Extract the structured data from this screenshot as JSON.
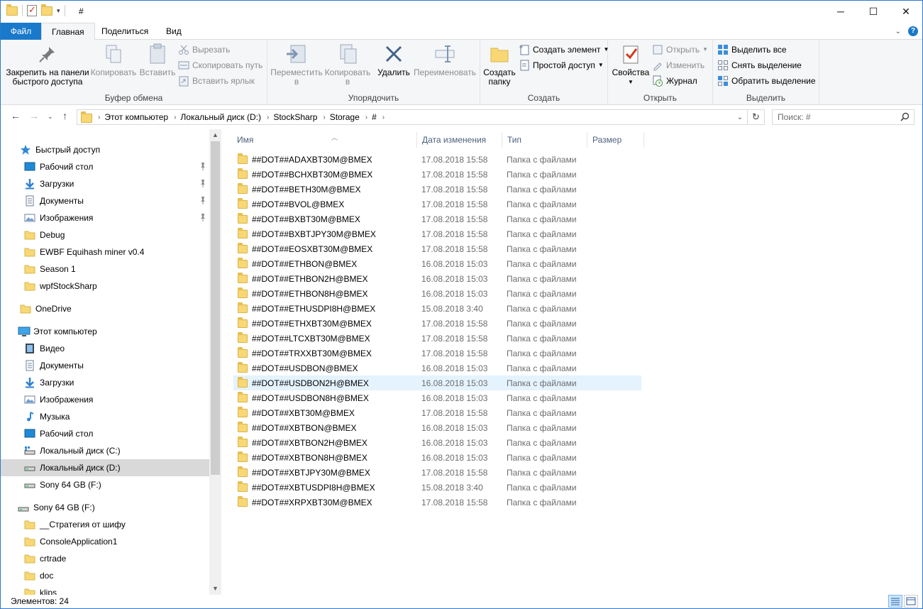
{
  "window": {
    "title": "#",
    "controls": {
      "minimize": "─",
      "maximize": "☐",
      "close": "✕"
    }
  },
  "ribbon_tabs": [
    {
      "label": "Файл"
    },
    {
      "label": "Главная"
    },
    {
      "label": "Поделиться"
    },
    {
      "label": "Вид"
    }
  ],
  "ribbon": {
    "clipboard": {
      "label": "Буфер обмена",
      "pin": "Закрепить на панели быстрого доступа",
      "pin_line1": "Закрепить на панели",
      "pin_line2": "быстрого доступа",
      "copy": "Копировать",
      "paste": "Вставить",
      "cut": "Вырезать",
      "copy_path": "Скопировать путь",
      "paste_shortcut": "Вставить ярлык"
    },
    "organize": {
      "label": "Упорядочить",
      "move_line1": "Переместить",
      "move_line2": "в",
      "copy_line1": "Копировать",
      "copy_line2": "в",
      "delete": "Удалить",
      "rename": "Переименовать"
    },
    "create": {
      "label": "Создать",
      "new_folder_line1": "Создать",
      "new_folder_line2": "папку",
      "new_item": "Создать элемент",
      "easy_access": "Простой доступ"
    },
    "open": {
      "label": "Открыть",
      "properties": "Свойства",
      "open": "Открыть",
      "edit": "Изменить",
      "history": "Журнал"
    },
    "select": {
      "label": "Выделить",
      "select_all": "Выделить все",
      "select_none": "Снять выделение",
      "invert": "Обратить выделение"
    }
  },
  "address": {
    "crumbs": [
      "Этот компьютер",
      "Локальный диск (D:)",
      "StockSharp",
      "Storage",
      "#"
    ]
  },
  "search": {
    "placeholder": "Поиск: #"
  },
  "nav": {
    "quick_access": "Быстрый доступ",
    "quick_items": [
      {
        "label": "Рабочий стол",
        "icon": "desktop-icon",
        "pinned": true
      },
      {
        "label": "Загрузки",
        "icon": "downloads-icon",
        "pinned": true
      },
      {
        "label": "Документы",
        "icon": "documents-icon",
        "pinned": true
      },
      {
        "label": "Изображения",
        "icon": "pictures-icon",
        "pinned": true
      },
      {
        "label": "Debug",
        "icon": "folder-icon",
        "pinned": false
      },
      {
        "label": "EWBF Equihash miner v0.4",
        "icon": "folder-icon",
        "pinned": false
      },
      {
        "label": "Season 1",
        "icon": "folder-icon",
        "pinned": false
      },
      {
        "label": "wpfStockSharp",
        "icon": "folder-icon",
        "pinned": false
      }
    ],
    "onedrive": "OneDrive",
    "this_pc": "Этот компьютер",
    "pc_items": [
      {
        "label": "Видео",
        "icon": "video-icon"
      },
      {
        "label": "Документы",
        "icon": "documents-icon"
      },
      {
        "label": "Загрузки",
        "icon": "downloads-icon"
      },
      {
        "label": "Изображения",
        "icon": "pictures-icon"
      },
      {
        "label": "Музыка",
        "icon": "music-icon"
      },
      {
        "label": "Рабочий стол",
        "icon": "desktop-icon"
      },
      {
        "label": "Локальный диск (C:)",
        "icon": "drive-c-icon"
      },
      {
        "label": "Локальный диск (D:)",
        "icon": "drive-icon"
      },
      {
        "label": "Sony 64 GB (F:)",
        "icon": "usb-drive-icon"
      }
    ],
    "sony": "Sony 64 GB (F:)",
    "sony_items": [
      {
        "label": "__Стратегия от шифу",
        "icon": "folder-icon"
      },
      {
        "label": "ConsoleApplication1",
        "icon": "folder-icon"
      },
      {
        "label": "crtrade",
        "icon": "folder-icon"
      },
      {
        "label": "doc",
        "icon": "folder-icon"
      },
      {
        "label": "klips",
        "icon": "folder-icon"
      }
    ]
  },
  "columns": {
    "name": "Имя",
    "date": "Дата изменения",
    "type": "Тип",
    "size": "Размер"
  },
  "files": [
    {
      "name": "##DOT##ADAXBT30M@BMEX",
      "date": "17.08.2018 15:58",
      "type": "Папка с файлами"
    },
    {
      "name": "##DOT##BCHXBT30M@BMEX",
      "date": "17.08.2018 15:58",
      "type": "Папка с файлами"
    },
    {
      "name": "##DOT##BETH30M@BMEX",
      "date": "17.08.2018 15:58",
      "type": "Папка с файлами"
    },
    {
      "name": "##DOT##BVOL@BMEX",
      "date": "17.08.2018 15:58",
      "type": "Папка с файлами"
    },
    {
      "name": "##DOT##BXBT30M@BMEX",
      "date": "17.08.2018 15:58",
      "type": "Папка с файлами"
    },
    {
      "name": "##DOT##BXBTJPY30M@BMEX",
      "date": "17.08.2018 15:58",
      "type": "Папка с файлами"
    },
    {
      "name": "##DOT##EOSXBT30M@BMEX",
      "date": "17.08.2018 15:58",
      "type": "Папка с файлами"
    },
    {
      "name": "##DOT##ETHBON@BMEX",
      "date": "16.08.2018 15:03",
      "type": "Папка с файлами"
    },
    {
      "name": "##DOT##ETHBON2H@BMEX",
      "date": "16.08.2018 15:03",
      "type": "Папка с файлами"
    },
    {
      "name": "##DOT##ETHBON8H@BMEX",
      "date": "16.08.2018 15:03",
      "type": "Папка с файлами"
    },
    {
      "name": "##DOT##ETHUSDPI8H@BMEX",
      "date": "15.08.2018 3:40",
      "type": "Папка с файлами"
    },
    {
      "name": "##DOT##ETHXBT30M@BMEX",
      "date": "17.08.2018 15:58",
      "type": "Папка с файлами"
    },
    {
      "name": "##DOT##LTCXBT30M@BMEX",
      "date": "17.08.2018 15:58",
      "type": "Папка с файлами"
    },
    {
      "name": "##DOT##TRXXBT30M@BMEX",
      "date": "17.08.2018 15:58",
      "type": "Папка с файлами"
    },
    {
      "name": "##DOT##USDBON@BMEX",
      "date": "16.08.2018 15:03",
      "type": "Папка с файлами"
    },
    {
      "name": "##DOT##USDBON2H@BMEX",
      "date": "16.08.2018 15:03",
      "type": "Папка с файлами"
    },
    {
      "name": "##DOT##USDBON8H@BMEX",
      "date": "16.08.2018 15:03",
      "type": "Папка с файлами"
    },
    {
      "name": "##DOT##XBT30M@BMEX",
      "date": "17.08.2018 15:58",
      "type": "Папка с файлами"
    },
    {
      "name": "##DOT##XBTBON@BMEX",
      "date": "16.08.2018 15:03",
      "type": "Папка с файлами"
    },
    {
      "name": "##DOT##XBTBON2H@BMEX",
      "date": "16.08.2018 15:03",
      "type": "Папка с файлами"
    },
    {
      "name": "##DOT##XBTBON8H@BMEX",
      "date": "16.08.2018 15:03",
      "type": "Папка с файлами"
    },
    {
      "name": "##DOT##XBTJPY30M@BMEX",
      "date": "17.08.2018 15:58",
      "type": "Папка с файлами"
    },
    {
      "name": "##DOT##XBTUSDPI8H@BMEX",
      "date": "15.08.2018 3:40",
      "type": "Папка с файлами"
    },
    {
      "name": "##DOT##XRPXBT30M@BMEX",
      "date": "17.08.2018 15:58",
      "type": "Папка с файлами"
    }
  ],
  "hovered_row": 15,
  "status": {
    "items_text": "Элементов: 24"
  },
  "colors": {
    "accent": "#1979ca",
    "folder": "#f8d775",
    "hover": "#e5f3ff",
    "selected": "#d9d9d9"
  }
}
